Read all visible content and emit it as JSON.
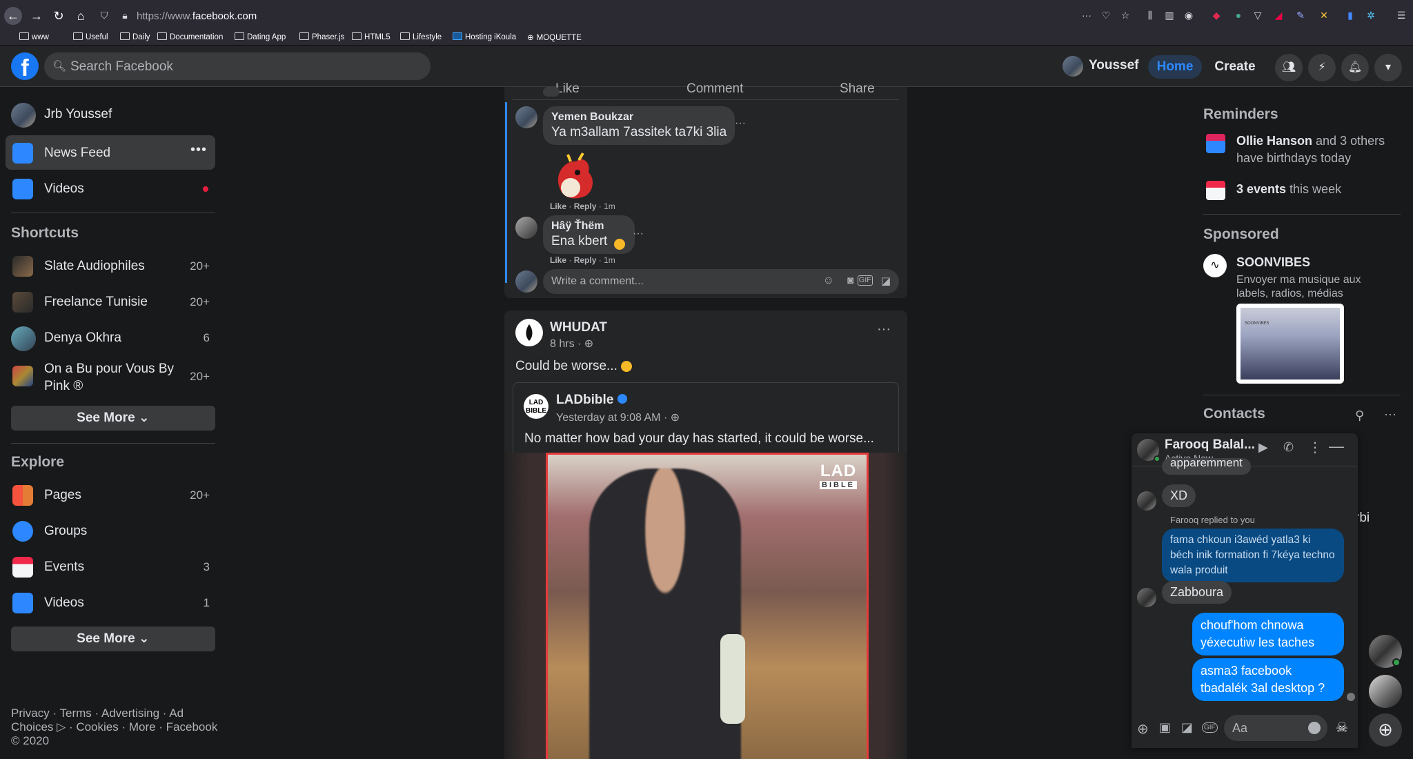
{
  "browser": {
    "url_prefix": "https://www.",
    "url_domain": "facebook.com",
    "bookmarks": [
      "www",
      "Useful",
      "Daily",
      "Documentation",
      "Dating App",
      "Phaser.js",
      "HTML5",
      "Lifestyle",
      "Hosting iKoula",
      "MOQUETTE"
    ]
  },
  "header": {
    "logo": "f",
    "search_placeholder": "Search Facebook",
    "user_name": "Youssef",
    "home_label": "Home",
    "create_label": "Create"
  },
  "left_sidebar": {
    "top_items": [
      {
        "label": "Jrb Youssef"
      },
      {
        "label": "News Feed"
      },
      {
        "label": "Videos"
      }
    ],
    "shortcuts_title": "Shortcuts",
    "shortcuts": [
      {
        "label": "Slate Audiophiles",
        "count": "20+"
      },
      {
        "label": "Freelance Tunisie",
        "count": "20+"
      },
      {
        "label": "Denya Okhra",
        "count": "6"
      },
      {
        "label": "On a Bu pour Vous By Pink ®",
        "count": "20+"
      }
    ],
    "see_more": "See More",
    "explore_title": "Explore",
    "explore": [
      {
        "label": "Pages",
        "count": "20+"
      },
      {
        "label": "Groups",
        "count": ""
      },
      {
        "label": "Events",
        "count": "3"
      },
      {
        "label": "Videos",
        "count": "1"
      }
    ],
    "see_more2": "See More",
    "footer": "Privacy · Terms · Advertising · Ad Choices ▷ · Cookies · More · Facebook © 2020"
  },
  "feed": {
    "post_actions": [
      "Like",
      "Comment",
      "Share"
    ],
    "comments": [
      {
        "name": "Yemen Boukzar",
        "text": "Ya m3allam 7assitek ta7ki 3lia",
        "meta_like": "Like",
        "meta_reply": "Reply",
        "time": "1m"
      },
      {
        "name": "Hâÿ Ťhëm",
        "text": "Ena kbert",
        "meta_like": "Like",
        "meta_reply": "Reply",
        "time": "1m"
      }
    ],
    "write_comment_placeholder": "Write a comment...",
    "post2": {
      "page": "WHUDAT",
      "time": "8 hrs",
      "text": "Could be worse...",
      "shared": {
        "page": "LADbible",
        "time": "Yesterday at 9:08 AM",
        "text": "No matter how bad your day has started, it could be worse...",
        "watermark_top": "LAD",
        "watermark_bottom": "BIBLE"
      }
    }
  },
  "right_sidebar": {
    "reminders_title": "Reminders",
    "birthday_name": "Ollie Hanson",
    "birthday_rest": " and 3 others have birthdays today",
    "events_bold": "3 events",
    "events_rest": " this week",
    "sponsored_title": "Sponsored",
    "sponsor_name": "SOONVIBES",
    "sponsor_text": "Envoyer ma musique aux labels, radios, médias",
    "sponsor_image_label": "SOONVIBES",
    "contacts_title": "Contacts",
    "contact_partial": "rbi"
  },
  "chat": {
    "name": "Farooq Balal...",
    "status": "Active Now",
    "partial_top": "apparemment",
    "messages": [
      {
        "dir": "in",
        "text": "XD"
      },
      {
        "dir": "note",
        "text": "Farooq replied to you"
      },
      {
        "dir": "reply",
        "text": "fama chkoun i3awéd yatla3 ki béch inik formation fi 7kéya techno wala produit"
      },
      {
        "dir": "in",
        "text": "Zabboura"
      },
      {
        "dir": "out",
        "text": "chouf'hom chnowa yéxecutiw les taches"
      },
      {
        "dir": "out",
        "text": "asma3 facebook tbadalék 3al desktop ?"
      }
    ],
    "input_placeholder": "Aa"
  },
  "colors": {
    "bg": "#18191a",
    "surface": "#242526",
    "accent": "#2d88ff",
    "messenger_blue": "#0084ff"
  }
}
